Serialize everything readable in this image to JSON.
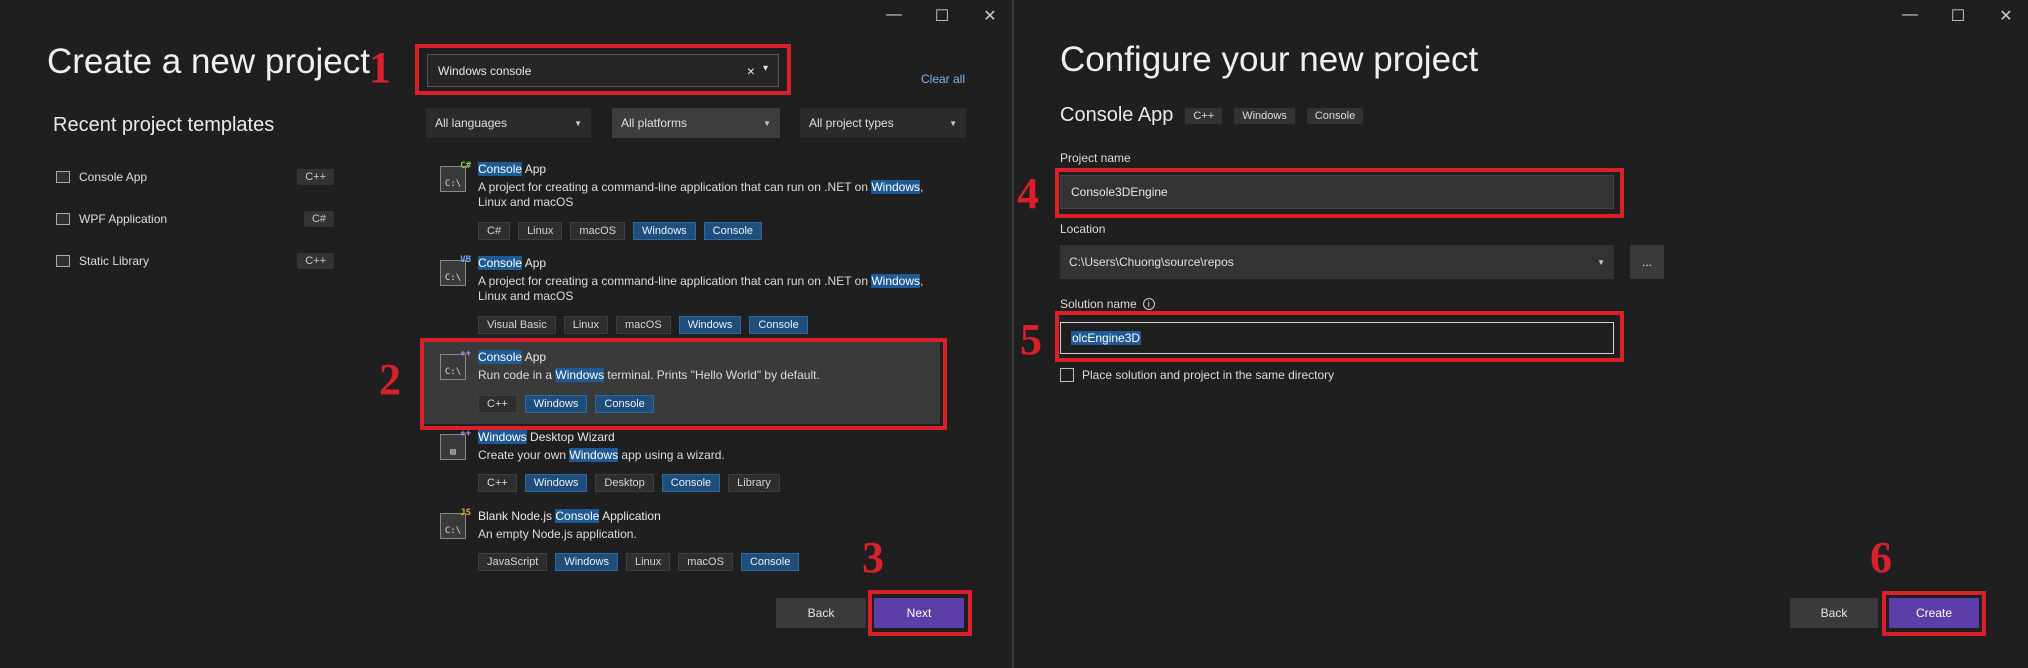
{
  "left": {
    "title": "Create a new project",
    "search": {
      "value": "Windows console",
      "clear_glyph": "×",
      "caret": "▾"
    },
    "clear_all": "Clear all",
    "filters": [
      {
        "label": "All languages"
      },
      {
        "label": "All platforms"
      },
      {
        "label": "All project types"
      }
    ],
    "recent_heading": "Recent project templates",
    "recent": [
      {
        "name": "Console App",
        "lang": "C++"
      },
      {
        "name": "WPF Application",
        "lang": "C#"
      },
      {
        "name": "Static Library",
        "lang": "C++"
      }
    ],
    "templates": [
      {
        "icon_badge": "C#",
        "title_hl": "Console",
        "title_rest": " App",
        "desc_a": "A project for creating a command-line application that can run on .NET on ",
        "desc_hl": "Windows",
        "desc_b": ",",
        "desc_c": "Linux and macOS",
        "tags": [
          "C#",
          "Linux",
          "macOS",
          "Windows",
          "Console"
        ]
      },
      {
        "icon_badge": "VB",
        "title_hl": "Console",
        "title_rest": " App",
        "desc_a": "A project for creating a command-line application that can run on .NET on ",
        "desc_hl": "Windows",
        "desc_b": ",",
        "desc_c": "Linux and macOS",
        "tags": [
          "Visual Basic",
          "Linux",
          "macOS",
          "Windows",
          "Console"
        ]
      },
      {
        "icon_badge": "++",
        "title_hl": "Console",
        "title_rest": " App",
        "desc_a": "Run code in a ",
        "desc_hl": "Windows",
        "desc_b": " terminal. Prints \"Hello World\" by default.",
        "tags": [
          "C++",
          "Windows",
          "Console"
        ]
      },
      {
        "icon_badge": "++",
        "title_hl": "Windows",
        "title_rest": " Desktop Wizard",
        "desc_a": "Create your own ",
        "desc_hl": "Windows",
        "desc_b": " app using a wizard.",
        "tags": [
          "C++",
          "Windows",
          "Desktop",
          "Console",
          "Library"
        ]
      },
      {
        "icon_badge": "JS",
        "title_pre": "Blank Node.js ",
        "title_hl": "Console",
        "title_rest": " Application",
        "desc_a": "An empty Node.js application.",
        "desc_hl": "",
        "desc_b": "",
        "tags": [
          "JavaScript",
          "Windows",
          "Linux",
          "macOS",
          "Console"
        ]
      }
    ],
    "back": "Back",
    "next": "Next"
  },
  "right": {
    "title": "Configure your new project",
    "template_name": "Console App",
    "chips": [
      "C++",
      "Windows",
      "Console"
    ],
    "project_name_label": "Project name",
    "project_name": "Console3DEngine",
    "location_label": "Location",
    "location": "C:\\Users\\Chuong\\source\\repos",
    "browse": "...",
    "solution_label": "Solution name",
    "info_glyph": "i",
    "solution_name": "olcEngine3D",
    "checkbox_label": "Place solution and project in the same directory",
    "back": "Back",
    "create": "Create"
  },
  "steps": [
    "1",
    "2",
    "3",
    "4",
    "5",
    "6"
  ],
  "window_controls": {
    "minimize": "—",
    "maximize": "☐",
    "close": "✕"
  },
  "colors": {
    "accent": "#5b3ea8",
    "annotation": "#d9202b",
    "highlight": "#1e5a96"
  }
}
